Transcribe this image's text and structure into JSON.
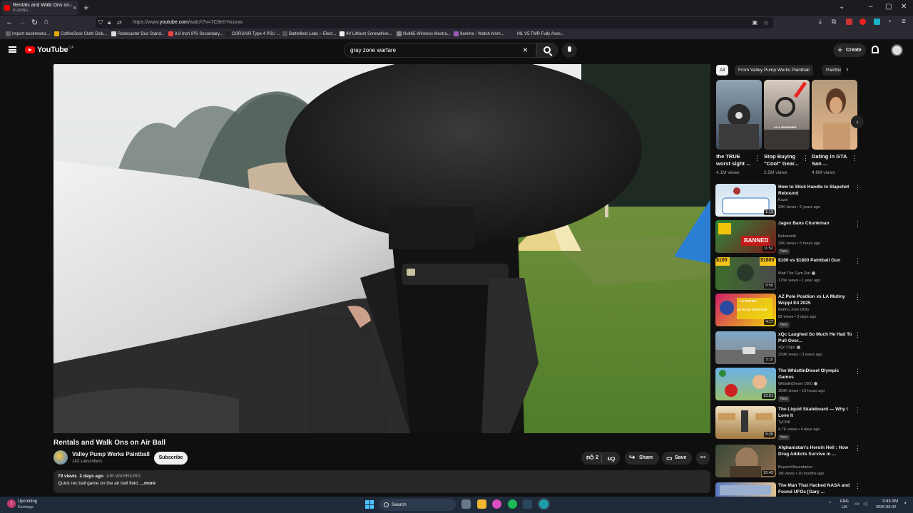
{
  "browser": {
    "tab_title": "Rentals and Walk Ons on Air Ball",
    "tab_status": "PLAYING",
    "tab_close": "×",
    "new_tab": "+",
    "url_prefix": "https://www.",
    "url_domain": "youtube.com",
    "url_path": "/watch?v=7C8e0-Nconw",
    "bookmarks": [
      "Import bookmarks...",
      "CoffeeSock Cloth Disk...",
      "Rodecaster Duo Stand...",
      "8.8 Inch IPS Secondary...",
      "CORSAIR Type 4 PSU ...",
      "Battlefield Labs – Elect...",
      "4V Lithium Screwdrive...",
      "Nuit65 Wireless Mecha...",
      "9anime - Watch Anim...",
      "M1 V5 TMR Fully Asse..."
    ]
  },
  "youtube": {
    "logo_text": "YouTube",
    "logo_region": "CA",
    "search_value": "gray zone warfare",
    "search_clear": "×",
    "create_label": "Create"
  },
  "video": {
    "title": "Rentals and Walk Ons on Air Ball",
    "channel": "Valley Pump Werks Paintball",
    "subscribers": "143 subscribers",
    "subscribe_label": "Subscribe",
    "likes": "2",
    "share_label": "Share",
    "save_label": "Save",
    "more_label": "•••",
    "views": "79 views",
    "age": "2 days ago",
    "tag": "AIR WARRIORS",
    "description": "Quick rec ball game on the air ball field.",
    "desc_more": "...more"
  },
  "chips": [
    "All",
    "From Valley Pump Werks Paintball",
    "Paintball"
  ],
  "chip_next": "›",
  "shorts": [
    {
      "title": "the TRUE worst sight ...",
      "views": "4.1M views"
    },
    {
      "title": "Stop Buying \"Cool\" Gear...",
      "views": "2.5M views"
    },
    {
      "title": "Dating in GTA San ...",
      "views": "4.9M views"
    }
  ],
  "shorts_dots": "⋮",
  "thumb_texts": {
    "beginner": "AS A BEGINNER",
    "banned": "BANNED",
    "price_low": "$100",
    "price_high": "$1800",
    "mutiny": "LA MUTINY",
    "pole": "AZ POLE POSITION"
  },
  "recommendations": [
    {
      "title": "How to Stick Handle in Slapshot Rebound",
      "channel": "Kazsi",
      "verified": false,
      "meta": "29K views • 2 years ago",
      "duration": "1:13",
      "badge": ""
    },
    {
      "title": "Jagex Bans Chunkman",
      "channel": "Behemeth",
      "verified": false,
      "meta": "29K views • 5 hours ago",
      "duration": "11:52",
      "badge": "New"
    },
    {
      "title": "$100 vs $1800 Paintball Gun",
      "channel": "Matt The Gym Rat",
      "verified": true,
      "meta": "176K views • 1 year ago",
      "duration": "8:50",
      "badge": ""
    },
    {
      "title": "AZ Pole Position vs LA Mutiny Wcppl E4 2025",
      "channel": "Rufino Josh ONG",
      "verified": false,
      "meta": "82 views • 3 days ago",
      "duration": "4:17",
      "badge": "New"
    },
    {
      "title": "xQc Laughed So Much He Had To Pull Over...",
      "channel": "xQc Clips",
      "verified": true,
      "meta": "259K views • 3 years ago",
      "duration": "3:15",
      "badge": ""
    },
    {
      "title": "The WhistlinDiesel Olympic Games",
      "channel": "WhistlinDiesel 1000",
      "verified": true,
      "meta": "359K views • 13 hours ago",
      "duration": "13:01",
      "badge": "New"
    },
    {
      "title": "The Liquid Skateboard — Why I Love It",
      "channel": "TyChill",
      "verified": false,
      "meta": "4.7K views • 4 days ago",
      "duration": "8:25",
      "badge": "New"
    },
    {
      "title": "Afghanistan's Heroin Hell : How Drug Addicts Survive in ...",
      "channel": "Beyond Boundaries",
      "verified": false,
      "meta": "1M views • 10 months ago",
      "duration": "20:43",
      "badge": ""
    },
    {
      "title": "The Man That Hacked NASA and Found UFOs [Gary ...",
      "channel": "",
      "verified": false,
      "meta": "",
      "duration": "",
      "badge": ""
    }
  ],
  "taskbar": {
    "earnings_title": "Upcoming",
    "earnings_sub": "Earnings",
    "earnings_count": "1",
    "search_placeholder": "Search",
    "lang1": "ENG",
    "lang2": "US",
    "time": "3:43 AM",
    "date": "2026-03-02"
  }
}
